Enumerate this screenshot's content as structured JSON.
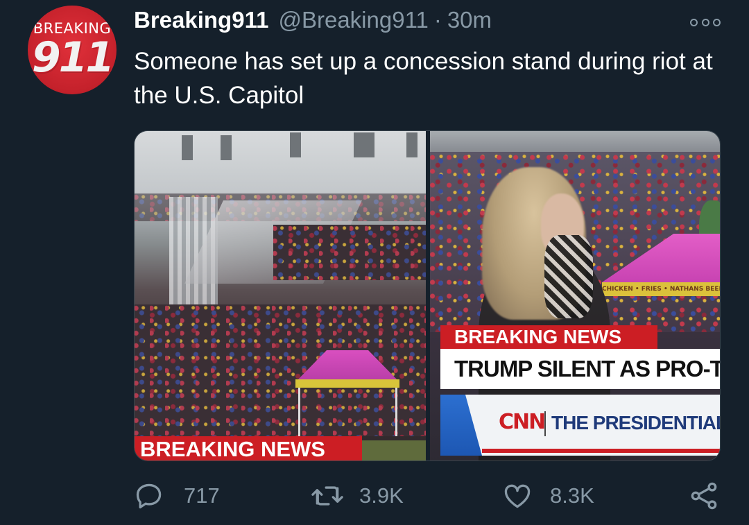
{
  "tweet": {
    "avatar": {
      "top_text": "BREAKING",
      "number_text": "911",
      "bg_color": "#c4212b"
    },
    "display_name": "Breaking911",
    "handle": "@Breaking911",
    "separator": "·",
    "timestamp": "30m",
    "text": "Someone has set up a concession stand during riot at the U.S. Capitol",
    "more_icon": "more-options-icon",
    "media": {
      "left_image": {
        "lower_third": "BREAKING NEWS"
      },
      "right_image": {
        "breaking_label": "BREAKING NEWS",
        "headline": "TRUMP SILENT AS PRO-TI",
        "network": "CNN",
        "sub_headline": "THE PRESIDENTIAL ELEC",
        "tent_banner": "CHICKEN • FRIES • NATHANS BEEF"
      }
    },
    "actions": {
      "reply": {
        "icon": "reply-icon",
        "count": "717"
      },
      "retweet": {
        "icon": "retweet-icon",
        "count": "3.9K"
      },
      "like": {
        "icon": "heart-icon",
        "count": "8.3K"
      },
      "share": {
        "icon": "share-icon"
      }
    },
    "colors": {
      "background": "#15202b",
      "secondary_text": "#8899a6",
      "cnn_red": "#cc1e24"
    }
  }
}
